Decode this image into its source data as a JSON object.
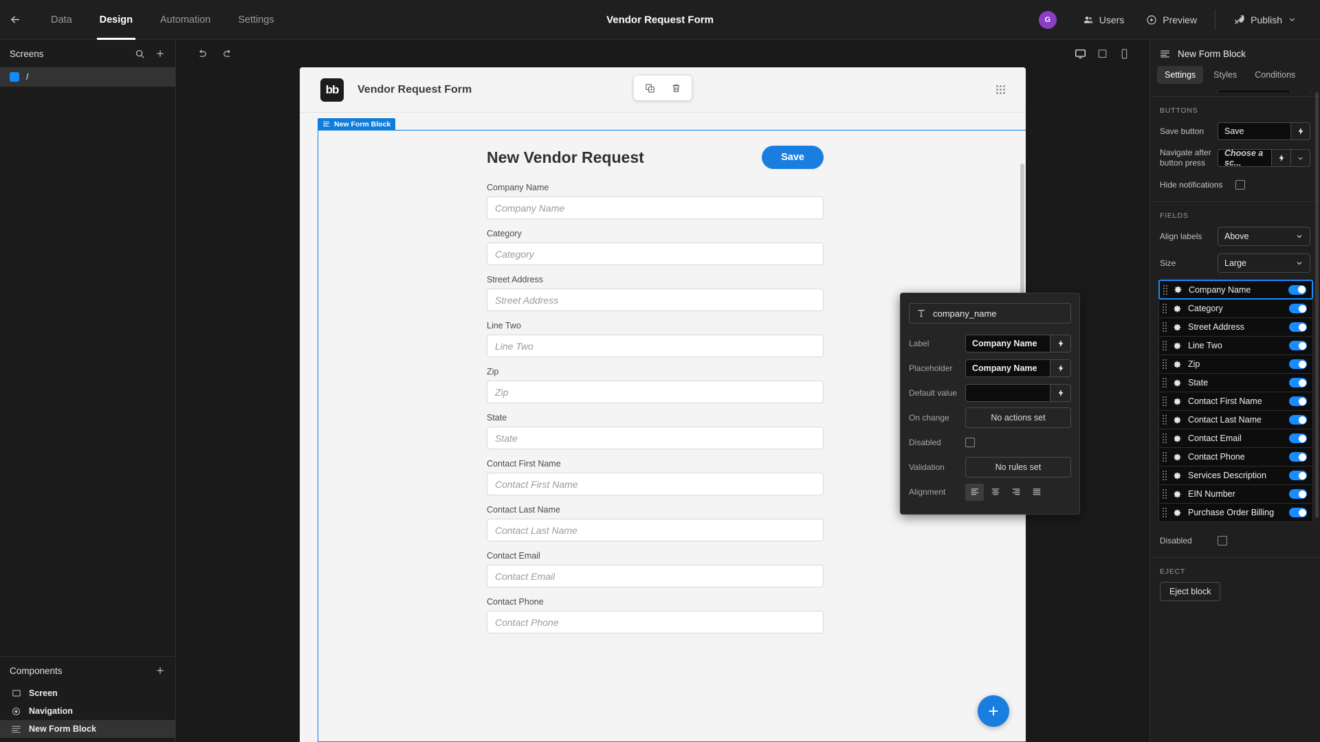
{
  "topbar": {
    "back_icon": "arrow-left-icon",
    "tabs": [
      {
        "label": "Data",
        "active": false
      },
      {
        "label": "Design",
        "active": true
      },
      {
        "label": "Automation",
        "active": false
      },
      {
        "label": "Settings",
        "active": false
      }
    ],
    "title": "Vendor Request Form",
    "avatar_initial": "G",
    "avatar_color": "#8c3ec4",
    "users_label": "Users",
    "preview_label": "Preview",
    "publish_label": "Publish"
  },
  "left_panel": {
    "screens_title": "Screens",
    "screens": [
      {
        "label": "/",
        "selected": true
      }
    ],
    "components_title": "Components",
    "components": [
      {
        "label": "Screen",
        "icon": "screen-icon",
        "selected": false
      },
      {
        "label": "Navigation",
        "icon": "eye-icon",
        "selected": false
      },
      {
        "label": "New Form Block",
        "icon": "form-block-icon",
        "selected": true
      }
    ]
  },
  "canvas_bar": {
    "undo_icon": "undo-icon",
    "redo_icon": "redo-icon",
    "devices": [
      {
        "name": "desktop",
        "active": true
      },
      {
        "name": "tablet",
        "active": false
      },
      {
        "name": "mobile",
        "active": false
      }
    ]
  },
  "canvas": {
    "logo_text": "bb",
    "preview_title": "Vendor Request Form",
    "toolbar": [
      {
        "name": "duplicate-icon"
      },
      {
        "name": "delete-icon"
      }
    ],
    "block_tag": "New Form Block",
    "form_title": "New Vendor Request",
    "save_label": "Save",
    "fab_label": "+",
    "fields": [
      {
        "label": "Company Name",
        "placeholder": "Company Name"
      },
      {
        "label": "Category",
        "placeholder": "Category"
      },
      {
        "label": "Street Address",
        "placeholder": "Street Address"
      },
      {
        "label": "Line Two",
        "placeholder": "Line Two"
      },
      {
        "label": "Zip",
        "placeholder": "Zip"
      },
      {
        "label": "State",
        "placeholder": "State"
      },
      {
        "label": "Contact First Name",
        "placeholder": "Contact First Name"
      },
      {
        "label": "Contact Last Name",
        "placeholder": "Contact Last Name"
      },
      {
        "label": "Contact Email",
        "placeholder": "Contact Email"
      },
      {
        "label": "Contact Phone",
        "placeholder": "Contact Phone"
      }
    ]
  },
  "popover": {
    "field_key": "company_name",
    "type_icon": "text-type-icon",
    "rows": {
      "label_label": "Label",
      "label_value": "Company Name",
      "placeholder_label": "Placeholder",
      "placeholder_value": "Company Name",
      "default_label": "Default value",
      "default_value": "",
      "onchange_label": "On change",
      "onchange_value": "No actions set",
      "disabled_label": "Disabled",
      "validation_label": "Validation",
      "validation_value": "No rules set",
      "alignment_label": "Alignment"
    },
    "alignment_options": [
      "align-left-icon",
      "align-center-icon",
      "align-right-icon",
      "align-justify-icon"
    ],
    "alignment_selected": 0
  },
  "right_panel": {
    "title": "New Form Block",
    "tabs": [
      {
        "label": "Settings",
        "active": true
      },
      {
        "label": "Styles",
        "active": false
      },
      {
        "label": "Conditions",
        "active": false
      }
    ],
    "buttons_section": "Buttons",
    "save_button_label": "Save button",
    "save_button_value": "Save",
    "navigate_label": "Navigate after button press",
    "navigate_value": "Choose a sc...",
    "hide_notifications_label": "Hide notifications",
    "fields_section": "Fields",
    "align_labels_label": "Align labels",
    "align_labels_value": "Above",
    "size_label": "Size",
    "size_value": "Large",
    "fields": [
      {
        "label": "Company Name",
        "enabled": true,
        "selected": true
      },
      {
        "label": "Category",
        "enabled": true,
        "selected": false
      },
      {
        "label": "Street Address",
        "enabled": true,
        "selected": false
      },
      {
        "label": "Line Two",
        "enabled": true,
        "selected": false
      },
      {
        "label": "Zip",
        "enabled": true,
        "selected": false
      },
      {
        "label": "State",
        "enabled": true,
        "selected": false
      },
      {
        "label": "Contact First Name",
        "enabled": true,
        "selected": false
      },
      {
        "label": "Contact Last Name",
        "enabled": true,
        "selected": false
      },
      {
        "label": "Contact Email",
        "enabled": true,
        "selected": false
      },
      {
        "label": "Contact Phone",
        "enabled": true,
        "selected": false
      },
      {
        "label": "Services Description",
        "enabled": true,
        "selected": false
      },
      {
        "label": "EIN Number",
        "enabled": true,
        "selected": false
      },
      {
        "label": "Purchase Order Billing",
        "enabled": true,
        "selected": false
      }
    ],
    "disabled_label": "Disabled",
    "eject_section": "Eject",
    "eject_button": "Eject block"
  },
  "colors": {
    "accent_blue": "#1a8cff",
    "canvas_blue": "#0f7ddb",
    "avatar_purple": "#8c3ec4"
  }
}
